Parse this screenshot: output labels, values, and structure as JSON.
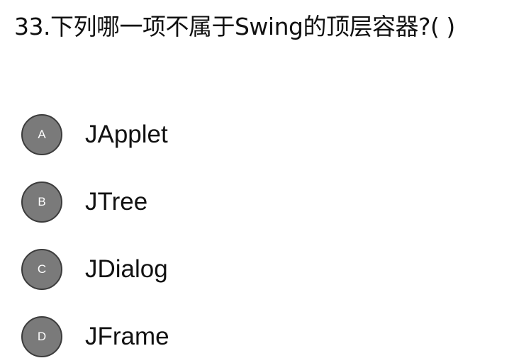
{
  "question": {
    "text": "33.下列哪一项不属于Swing的顶层容器?(  )"
  },
  "options": [
    {
      "letter": "A",
      "text": "JApplet"
    },
    {
      "letter": "B",
      "text": "JTree"
    },
    {
      "letter": "C",
      "text": "JDialog"
    },
    {
      "letter": "D",
      "text": "JFrame"
    }
  ],
  "colors": {
    "badge_fill": "#7a7a7a",
    "badge_border": "#3c3c3c",
    "badge_text": "#ffffff",
    "text": "#111111"
  }
}
